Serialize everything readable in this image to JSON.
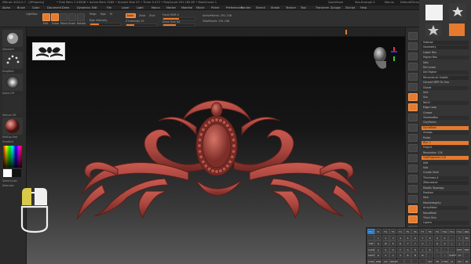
{
  "app": {
    "title_left": "ZBrush 2022.0.7 - [ZProjects]",
    "title_mid": "• Free Mem 7.435GB • Active Mem 1589 • Scratch Disk 97 • Timer 0.472 • PolyCount 291.165 KP • MeshCount 1",
    "title_right": "QuickSave",
    "title_see": "See-through 0",
    "title_menus": "Menus",
    "title_script": "DefaultZScript"
  },
  "menubar": [
    "Alpha",
    "Brush",
    "Color",
    "Document",
    "Draw",
    "Dynamics",
    "Edit",
    "File",
    "Layer",
    "Light",
    "Macro",
    "Marker",
    "Material",
    "Movie",
    "Picker",
    "Preferences",
    "Render",
    "Stencil",
    "Stroke",
    "Texture",
    "Tool",
    "Transform",
    "Zplugin",
    "Zscript",
    "Help"
  ],
  "shelf": {
    "lightbox": "LightBox",
    "edit": "Edit",
    "draw": "Draw",
    "move": "Move",
    "scale": "Scale",
    "rotate": "Rotate",
    "mrgb": "Mrgb",
    "rgb": "Rgb",
    "m": "M",
    "zadd": "Zadd",
    "zsub": "Zsub",
    "zcut": "Zcut",
    "rgb_intensity_label": "Rgb Intensity",
    "focal_shift_label": "Focal Shift 0",
    "draw_size_label": "Draw Size 64",
    "z_intensity_label": "Z Intensity 25",
    "active_points": "ActivePoints: 291.158",
    "total_points": "TotalPoints: 291.158",
    "rgb_intensity": 0.3,
    "z_intensity": 0.25,
    "focal_shift": 0.5,
    "draw_size": 0.4
  },
  "leftbar": {
    "tiles": [
      "Standard",
      "DragRect",
      "Alpha Off",
      "Texture Off",
      "MatCap Red"
    ],
    "gradient": "Gradient",
    "switch": "SwitchColor",
    "alternate": "Alternate"
  },
  "panel": {
    "rows": [
      "Subtool",
      "Geometry",
      "Lower Res",
      "Higher Res",
      "Sdiv",
      "Del Lower",
      "Del Higher",
      "Reconstruct Subdiv",
      "Convert BPR To Geo",
      "Divide",
      "Smt",
      "Suv",
      "ReUV",
      "Edge Loop",
      "Crease",
      "ShadowBox",
      "ClayPolish",
      "DynaMesh",
      "Groups",
      "Polish",
      "Blur 2",
      "Project",
      "Resolution 128",
      "SubProjection 0.6",
      "Add",
      "Sub",
      "Create Shell",
      "Thickness 4",
      "ZRemesher",
      "Modify Topology",
      "Position",
      "Size",
      "MeshIntegrity",
      "ArrayMesh",
      "NanoMesh",
      "Thick Skin",
      "Layers"
    ],
    "orange_rows": [
      17,
      20,
      23
    ],
    "hdr_rows": [
      0,
      1,
      7,
      17,
      28
    ]
  },
  "keys": {
    "rows": [
      [
        "ESC",
        "F1",
        "F2",
        "F3",
        "F4",
        "F5",
        "F6",
        "F7",
        "F8",
        "F9",
        "F10",
        "F11",
        "F12",
        "DEL"
      ],
      [
        "`",
        "1",
        "2",
        "3",
        "4",
        "5",
        "6",
        "7",
        "8",
        "9",
        "0",
        "-",
        "=",
        "BS"
      ],
      [
        "TAB",
        "Q",
        "W",
        "E",
        "R",
        "T",
        "Y",
        "U",
        "I",
        "O",
        "P",
        "[",
        "]",
        "\\"
      ],
      [
        "CAPS",
        "A",
        "S",
        "D",
        "F",
        "G",
        "H",
        "J",
        "K",
        "L",
        ";",
        "'",
        "ENT",
        "ENT"
      ],
      [
        "SHIFT",
        "Z",
        "X",
        "C",
        "V",
        "B",
        "N",
        "M",
        ",",
        ".",
        "/",
        "SHIFT",
        "UP",
        ""
      ],
      [
        "CTRL",
        "WIN",
        "ALT",
        "SPACE",
        "",
        "",
        "",
        "",
        "ALT",
        "FN",
        "CTRL",
        "LT",
        "DN",
        "RT"
      ]
    ],
    "highlight": [
      "ESC"
    ]
  },
  "colors": {
    "accent": "#e67a2e",
    "model": "#a8463f",
    "highlight_key": "#1f6fbf"
  }
}
